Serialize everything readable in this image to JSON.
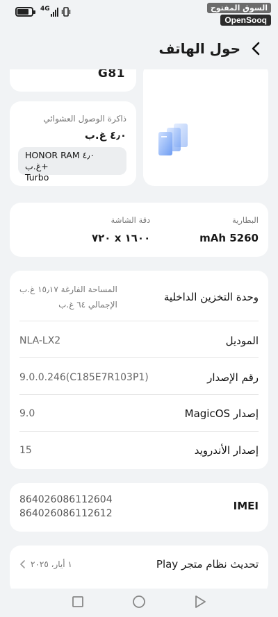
{
  "status_bar": {
    "network": "4G",
    "battery_level": 0.8
  },
  "watermark": {
    "arabic": "السوق المفتوح",
    "english": "OpenSooq"
  },
  "header": {
    "title": "حول الهاتف"
  },
  "processor": {
    "value": "G81"
  },
  "ram": {
    "label": "ذاكرة الوصول العشوائي",
    "value": "٤٫٠ غ.ب",
    "chip_line1": "HONOR RAM ٤٫٠ غ.ب+",
    "chip_line2": "Turbo"
  },
  "battery": {
    "label": "البطارية",
    "value": "mAh 5260"
  },
  "screen": {
    "label": "دقة الشاشة",
    "value": "١٦٠٠ x ٧٢٠"
  },
  "storage": {
    "label": "وحدة التخزين الداخلية",
    "free": "المساحة الفارغة  ١٥٫١٧ غ.ب",
    "total": "الإجمالي  ٦٤ غ.ب"
  },
  "model": {
    "label": "الموديل",
    "value": "NLA-LX2"
  },
  "build": {
    "label": "رقم الإصدار",
    "value": "9.0.0.246(C185E7R103P1)"
  },
  "magicos": {
    "label": "إصدار MagicOS",
    "value": "9.0"
  },
  "android": {
    "label": "إصدار الأندرويد",
    "value": "15"
  },
  "imei": {
    "label": "IMEI",
    "value1": "864026086112604",
    "value2": "864026086112612"
  },
  "play_update": {
    "label": "تحديث نظام متجر Play",
    "value": "١ أيار، ٢٠٢٥"
  },
  "icons": {
    "back": "chevron-left-icon",
    "nav_recents": "square-icon",
    "nav_home": "circle-icon",
    "nav_back": "triangle-icon",
    "stack": "layers-icon"
  },
  "colors": {
    "background": "#f1f3f5",
    "card": "#ffffff",
    "accent_blue": "#5b8def"
  }
}
